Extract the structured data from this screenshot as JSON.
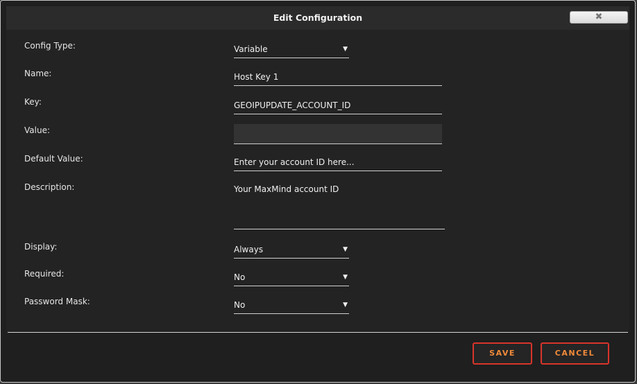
{
  "dialog": {
    "title": "Edit Configuration",
    "close_glyph": "✖"
  },
  "form": {
    "config_type": {
      "label": "Config Type:",
      "value": "Variable"
    },
    "name": {
      "label": "Name:",
      "value": "Host Key 1"
    },
    "key": {
      "label": "Key:",
      "value": "GEOIPUPDATE_ACCOUNT_ID"
    },
    "value": {
      "label": "Value:",
      "value": ""
    },
    "default_value": {
      "label": "Default Value:",
      "value": "Enter your account ID here..."
    },
    "description": {
      "label": "Description:",
      "value": "Your MaxMind account ID"
    },
    "display": {
      "label": "Display:",
      "value": "Always"
    },
    "required": {
      "label": "Required:",
      "value": "No"
    },
    "password_mask": {
      "label": "Password Mask:",
      "value": "No"
    }
  },
  "dropdown_caret": "▼",
  "footer": {
    "save_label": "SAVE",
    "cancel_label": "CANCEL"
  },
  "colors": {
    "background": "#1f1f1f",
    "button_border": "#d9342b",
    "button_text": "#f08a3a"
  }
}
